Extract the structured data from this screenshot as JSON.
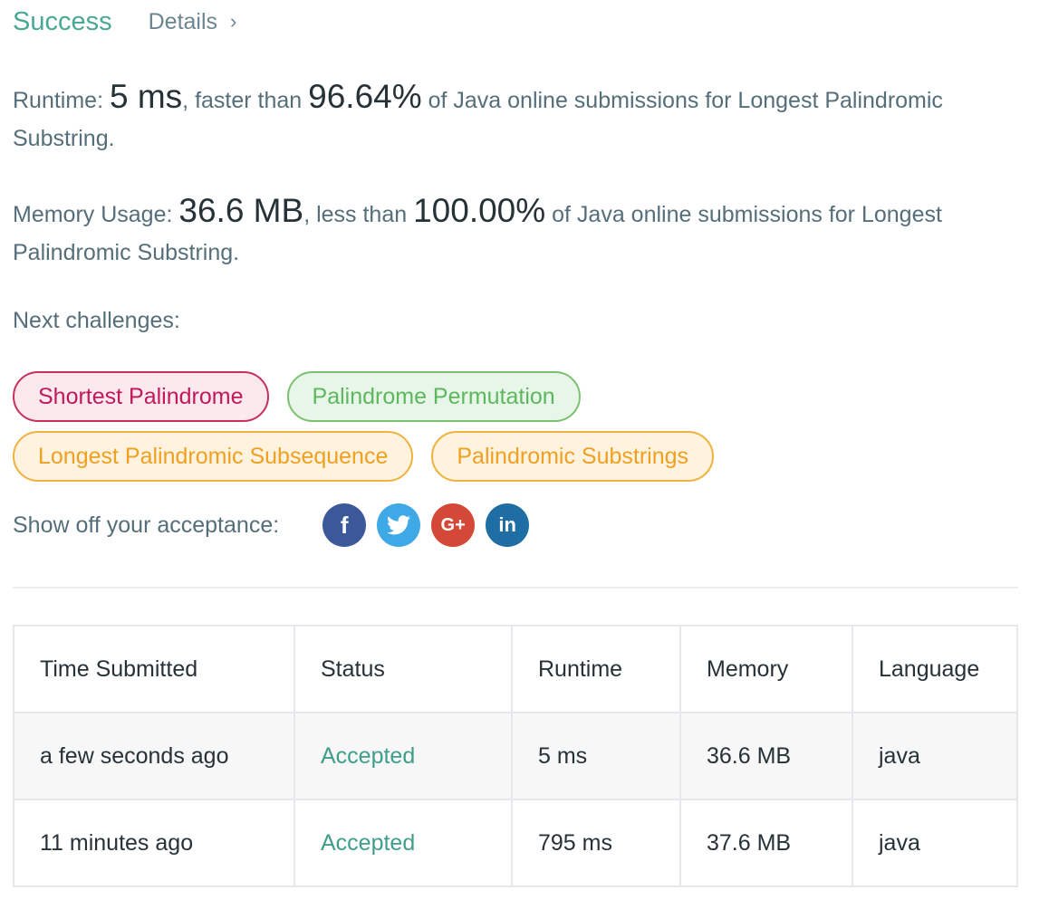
{
  "header": {
    "status": "Success",
    "details_label": "Details",
    "chevron": "›"
  },
  "runtime": {
    "label": "Runtime: ",
    "value": "5 ms",
    "mid": ", faster than ",
    "percent": "96.64%",
    "suffix": " of Java online submissions for Longest Palindromic Substring."
  },
  "memory": {
    "label": "Memory Usage: ",
    "value": "36.6 MB",
    "mid": ", less than ",
    "percent": "100.00%",
    "suffix": " of Java online submissions for Longest Palindromic Substring."
  },
  "next_challenges": {
    "label": "Next challenges:",
    "items": [
      {
        "label": "Shortest Palindrome",
        "difficulty": "hard"
      },
      {
        "label": "Palindrome Permutation",
        "difficulty": "easy"
      },
      {
        "label": "Longest Palindromic Subsequence",
        "difficulty": "medium"
      },
      {
        "label": "Palindromic Substrings",
        "difficulty": "medium"
      }
    ]
  },
  "share": {
    "label": "Show off your acceptance:",
    "icons": [
      {
        "name": "facebook-icon",
        "glyph": "f",
        "color": "#3b5998"
      },
      {
        "name": "twitter-icon",
        "glyph": "",
        "color": "#3fa9e8"
      },
      {
        "name": "google-plus-icon",
        "glyph": "G+",
        "color": "#d34836"
      },
      {
        "name": "linkedin-icon",
        "glyph": "in",
        "color": "#1f6ea3"
      }
    ]
  },
  "table": {
    "headers": [
      "Time Submitted",
      "Status",
      "Runtime",
      "Memory",
      "Language"
    ],
    "rows": [
      [
        "a few seconds ago",
        "Accepted",
        "5 ms",
        "36.6 MB",
        "java"
      ],
      [
        "11 minutes ago",
        "Accepted",
        "795 ms",
        "37.6 MB",
        "java"
      ]
    ]
  },
  "colors": {
    "success": "#4aa896",
    "hard": "#c2185b",
    "easy": "#5cb85c",
    "medium": "#f0a020",
    "accepted": "#3f9e8a"
  }
}
